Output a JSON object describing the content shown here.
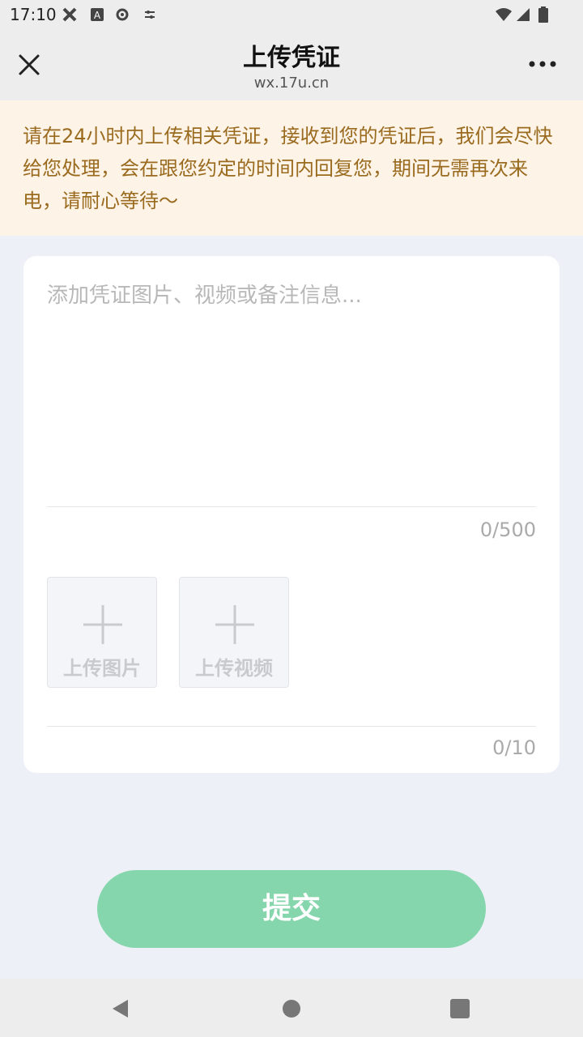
{
  "status_bar": {
    "time": "17:10",
    "icons": [
      "tools-icon",
      "font-icon",
      "settings-icon",
      "tune-icon",
      "wifi-icon",
      "signal-icon",
      "battery-icon"
    ]
  },
  "nav": {
    "title": "上传凭证",
    "subtitle": "wx.17u.cn",
    "close_icon": "close-icon",
    "more_icon": "more-icon"
  },
  "notice": {
    "text": "请在24小时内上传相关凭证，接收到您的凭证后，我们会尽快给您处理，会在跟您约定的时间内回复您，期间无需再次来电，请耐心等待～",
    "color": "#9a6b1e",
    "background": "#fdf3e7"
  },
  "form": {
    "remark_placeholder": "添加凭证图片、视频或备注信息...",
    "remark_value": "",
    "remark_counter": "0/500",
    "upload_image_label": "上传图片",
    "upload_video_label": "上传视频",
    "media_counter": "0/10"
  },
  "submit": {
    "label": "提交",
    "color": "#86d6ad"
  },
  "system_nav": {
    "icons": [
      "back-icon",
      "home-icon",
      "recents-icon"
    ]
  }
}
